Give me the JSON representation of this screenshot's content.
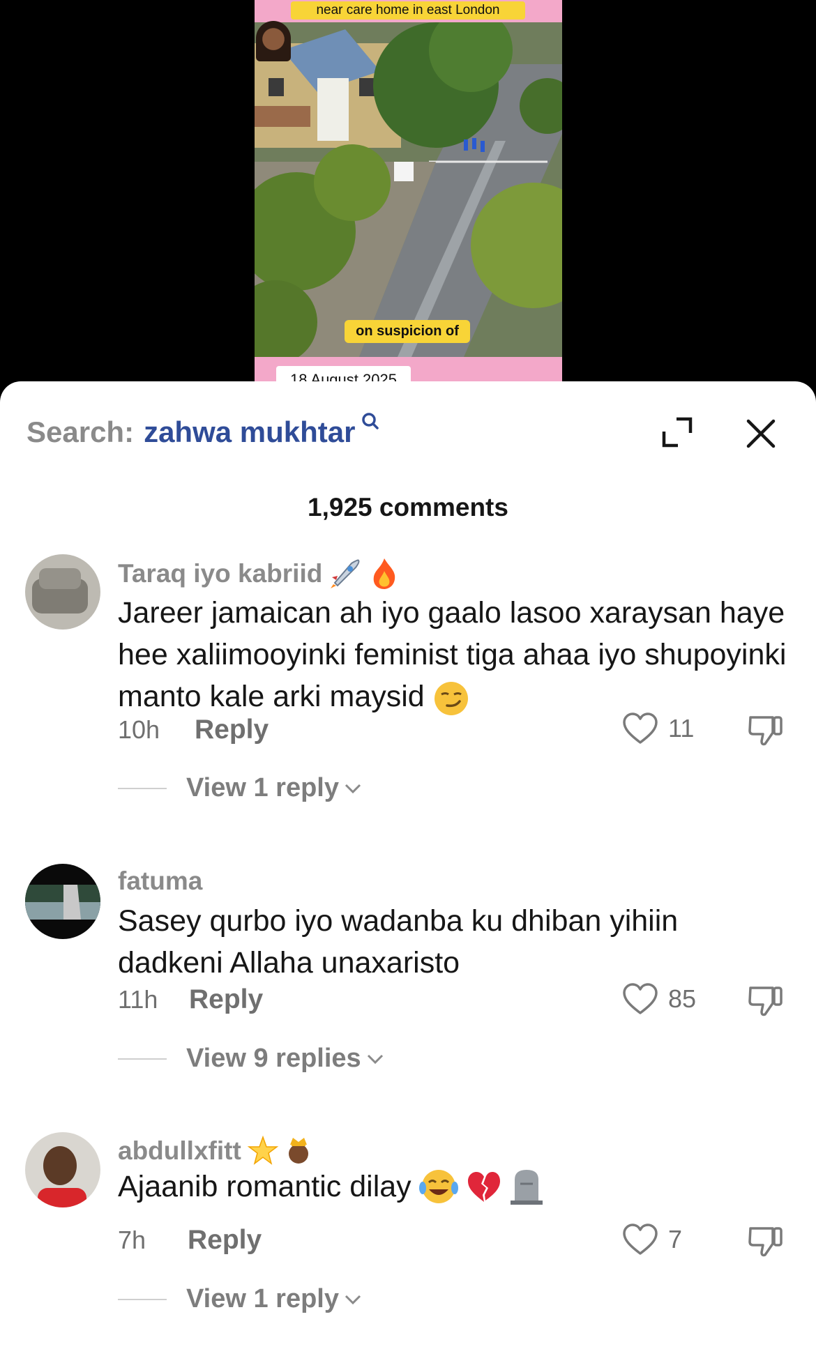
{
  "video": {
    "top_caption": "near care home in east London",
    "subtitle": "on suspicion of",
    "date_label": "18 August 2025"
  },
  "search": {
    "prefix": "Search:",
    "term": "zahwa mukhtar"
  },
  "comments_header": {
    "count_text": "1,925 comments"
  },
  "comments": [
    {
      "username": "Taraq iyo kabriid",
      "text": "Jareer jamaican ah iyo gaalo lasoo xaraysan haye hee xaliimooyinki feminist tiga ahaa iyo shupoyinki manto kale arki maysid",
      "time": "10h",
      "reply_label": "Reply",
      "likes": "11",
      "view_replies": "View 1 reply"
    },
    {
      "username": "fatuma",
      "text": "Sasey qurbo iyo wadanba ku dhiban yihiin dadkeni Allaha unaxaristo",
      "time": "11h",
      "reply_label": "Reply",
      "likes": "85",
      "view_replies": "View 9 replies"
    },
    {
      "username": "abdullxfitt",
      "text": "Ajaanib romantic dilay",
      "time": "7h",
      "reply_label": "Reply",
      "likes": "7",
      "view_replies": "View 1 reply"
    }
  ],
  "icons": {
    "search": "search-icon",
    "expand": "expand-icon",
    "close": "close-icon",
    "like": "heart-icon",
    "dislike": "thumbs-down-icon",
    "chevron": "chevron-down-icon"
  },
  "colors": {
    "search_term": "#2f4c98",
    "muted_text": "#8a8a8a",
    "caption_yellow": "#f8d437",
    "video_border_pink": "#f3a8c9"
  }
}
